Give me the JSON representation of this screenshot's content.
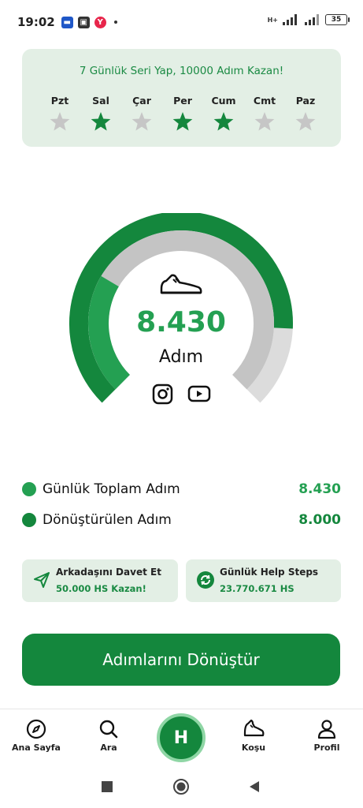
{
  "status_bar": {
    "time": "19:02",
    "battery": "35",
    "network": "H+"
  },
  "streak": {
    "title": "7 Günlük Seri Yap, 10000 Adım Kazan!",
    "days": [
      {
        "label": "Pzt",
        "done": false
      },
      {
        "label": "Sal",
        "done": true
      },
      {
        "label": "Çar",
        "done": false
      },
      {
        "label": "Per",
        "done": true
      },
      {
        "label": "Cum",
        "done": true
      },
      {
        "label": "Cmt",
        "done": false
      },
      {
        "label": "Paz",
        "done": false
      }
    ]
  },
  "gauge": {
    "value": "8.430",
    "unit": "Adım",
    "progress_fraction": 0.843,
    "converted_fraction": 0.8
  },
  "stats": {
    "total_label": "Günlük Toplam Adım",
    "total_value": "8.430",
    "converted_label": "Dönüştürülen Adım",
    "converted_value": "8.000"
  },
  "invite_card": {
    "title": "Arkadaşını Davet Et",
    "subtitle": "50.000 HS Kazan!"
  },
  "help_card": {
    "title": "Günlük Help Steps",
    "subtitle": "23.770.671 HS"
  },
  "cta_label": "Adımlarını Dönüştür",
  "bottom_nav": {
    "home": "Ana Sayfa",
    "search": "Ara",
    "center": "H",
    "run": "Koşu",
    "profile": "Profil"
  },
  "colors": {
    "primary": "#14873d",
    "accent": "#24a052",
    "light_card": "#e3efe5",
    "track": "#c4c4c4"
  }
}
